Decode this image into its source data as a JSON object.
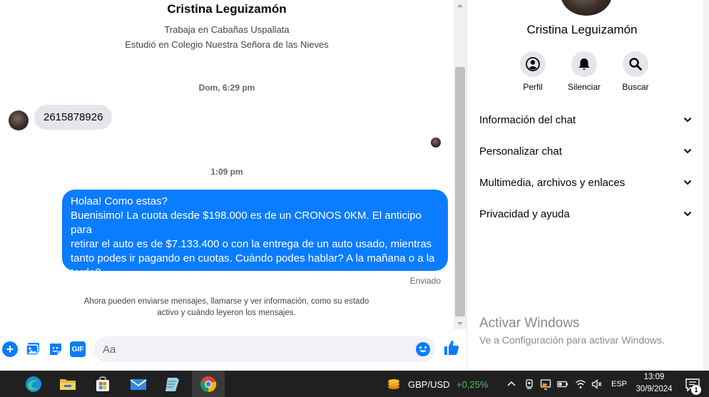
{
  "chat": {
    "contact_name": "Cristina Leguizamón",
    "work": "Trabaja en Cabañas Uspallata",
    "study": "Estudió en Colegio Nuestra Señora de las Nieves",
    "timestamp_1": "Dom, 6:29 pm",
    "timestamp_2": "1:09 pm",
    "incoming_message": "2615878926",
    "outgoing_message_lines": [
      "Holaa! Como estas?",
      "Buenisimo! La cuota desde $198.000 es de un CRONOS 0KM. El anticipo para",
      "retirar el auto es de $7.133.400 o con la entrega de un auto usado, mientras",
      "tanto podes ir pagando en cuotas. Cuándo podes hablar? A la mañana o a la",
      "tarde?"
    ],
    "sent_status": "Enviado",
    "info_note_line_1": "Ahora pueden enviarse mensajes, llamarse y ver información, como su estado",
    "info_note_line_2": "activo y cuándo leyeron los mensajes.",
    "accent_color": "#0a7cff"
  },
  "composer": {
    "placeholder": "Aa",
    "gif_label": "GIF",
    "plus_label": "+"
  },
  "panel": {
    "contact_name": "Cristina Leguizamón",
    "actions": [
      {
        "label": "Perfil",
        "icon": "profile-icon"
      },
      {
        "label": "Silenciar",
        "icon": "bell-icon"
      },
      {
        "label": "Buscar",
        "icon": "search-icon"
      }
    ],
    "sections": [
      "Información del chat",
      "Personalizar chat",
      "Multimedia, archivos y enlaces",
      "Privacidad y ayuda"
    ],
    "activate_title": "Activar Windows",
    "activate_subtitle": "Ve a Configuración para activar Windows."
  },
  "taskbar": {
    "apps": [
      "edge-icon",
      "file-explorer-icon",
      "store-icon",
      "mail-icon",
      "notepad-icon",
      "chrome-icon"
    ],
    "stock_name": "GBP/USD",
    "stock_change": "+0,25%",
    "language": "ESP",
    "time": "13:09",
    "date": "30/9/2024",
    "notification_count": "1"
  }
}
